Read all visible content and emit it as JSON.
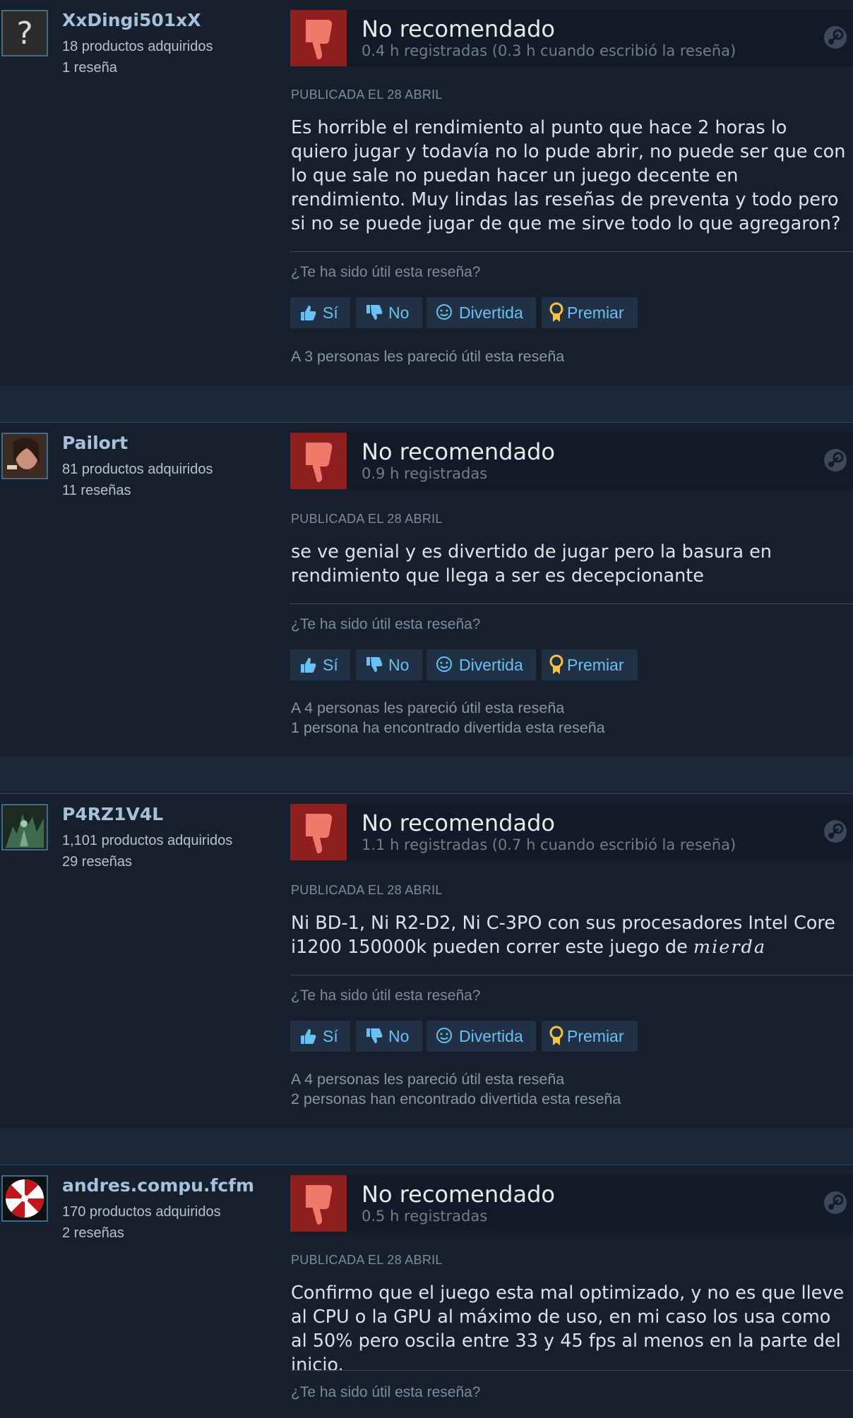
{
  "labels": {
    "verdict": "No recomendado",
    "question": "¿Te ha sido útil esta reseña?",
    "yes": "Sí",
    "no": "No",
    "funny": "Divertida",
    "award": "Premiar"
  },
  "colors": {
    "background": "#1b2838",
    "link": "#67c1f5",
    "negative": "#8f1f1f"
  },
  "reviews": [
    {
      "avatar": "question-mark-avatar",
      "username": "XxDingi501xX",
      "products": "18 productos adquiridos",
      "reviews": "1 reseña",
      "hours": "0.4 h registradas (0.3 h cuando escribió la reseña)",
      "posted": "PUBLICADA EL 28 ABRIL",
      "text": "Es horrible el rendimiento al punto que hace 2 horas lo quiero jugar y todavía no lo pude abrir, no puede ser que con lo que sale no puedan hacer un juego decente en rendimiento. Muy lindas las reseñas de preventa y todo pero si no se puede jugar de que me sirve todo lo que agregaron?",
      "helpful": "A 3 personas les pareció útil esta reseña",
      "funny": ""
    },
    {
      "avatar": "photo-avatar",
      "username": "Pailort",
      "products": "81 productos adquiridos",
      "reviews": "11 reseñas",
      "hours": "0.9 h registradas",
      "posted": "PUBLICADA EL 28 ABRIL",
      "text": "se ve genial y es divertido de jugar pero la basura en rendimiento que llega a ser es decepcionante",
      "helpful": "A 4 personas les pareció útil esta reseña",
      "funny": "1 persona ha encontrado divertida esta reseña"
    },
    {
      "avatar": "game-art-avatar",
      "username": "P4RZ1V4L",
      "products": "1,101 productos adquiridos",
      "reviews": "29 reseñas",
      "hours": "1.1 h registradas (0.7 h cuando escribió la reseña)",
      "posted": "PUBLICADA EL 28 ABRIL",
      "text": "Ni BD-1, Ni R2-D2, Ni C-3PO con sus procesadores Intel Core i1200 150000k pueden correr este juego de ",
      "text_styled": "mierda",
      "helpful": "A 4 personas les pareció útil esta reseña",
      "funny": "2 personas han encontrado divertida esta reseña"
    },
    {
      "avatar": "umbrella-logo-avatar",
      "username": "andres.compu.fcfm",
      "products": "170 productos adquiridos",
      "reviews": "2 reseñas",
      "hours": "0.5 h registradas",
      "posted": "PUBLICADA EL 28 ABRIL",
      "text": "Confirmo que el juego esta mal optimizado, y no es que lleve al CPU o la GPU al máximo de uso, en mi caso los usa como al 50% pero oscila entre 33 y 45 fps al menos en la parte del inicio.",
      "helpful": "",
      "funny": ""
    }
  ]
}
